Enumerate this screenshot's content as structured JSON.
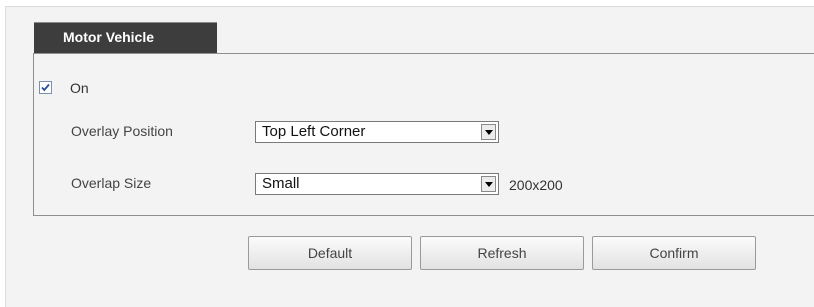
{
  "tab": {
    "label": "Motor Vehicle"
  },
  "enable": {
    "checked": true,
    "label": "On"
  },
  "overlay_position": {
    "label": "Overlay Position",
    "value": "Top Left Corner"
  },
  "overlap_size": {
    "label": "Overlap Size",
    "value": "Small",
    "dimension": "200x200"
  },
  "buttons": {
    "default": "Default",
    "refresh": "Refresh",
    "confirm": "Confirm"
  },
  "icons": {
    "checkbox_check": "check-icon",
    "dropdown": "chevron-down-icon"
  }
}
